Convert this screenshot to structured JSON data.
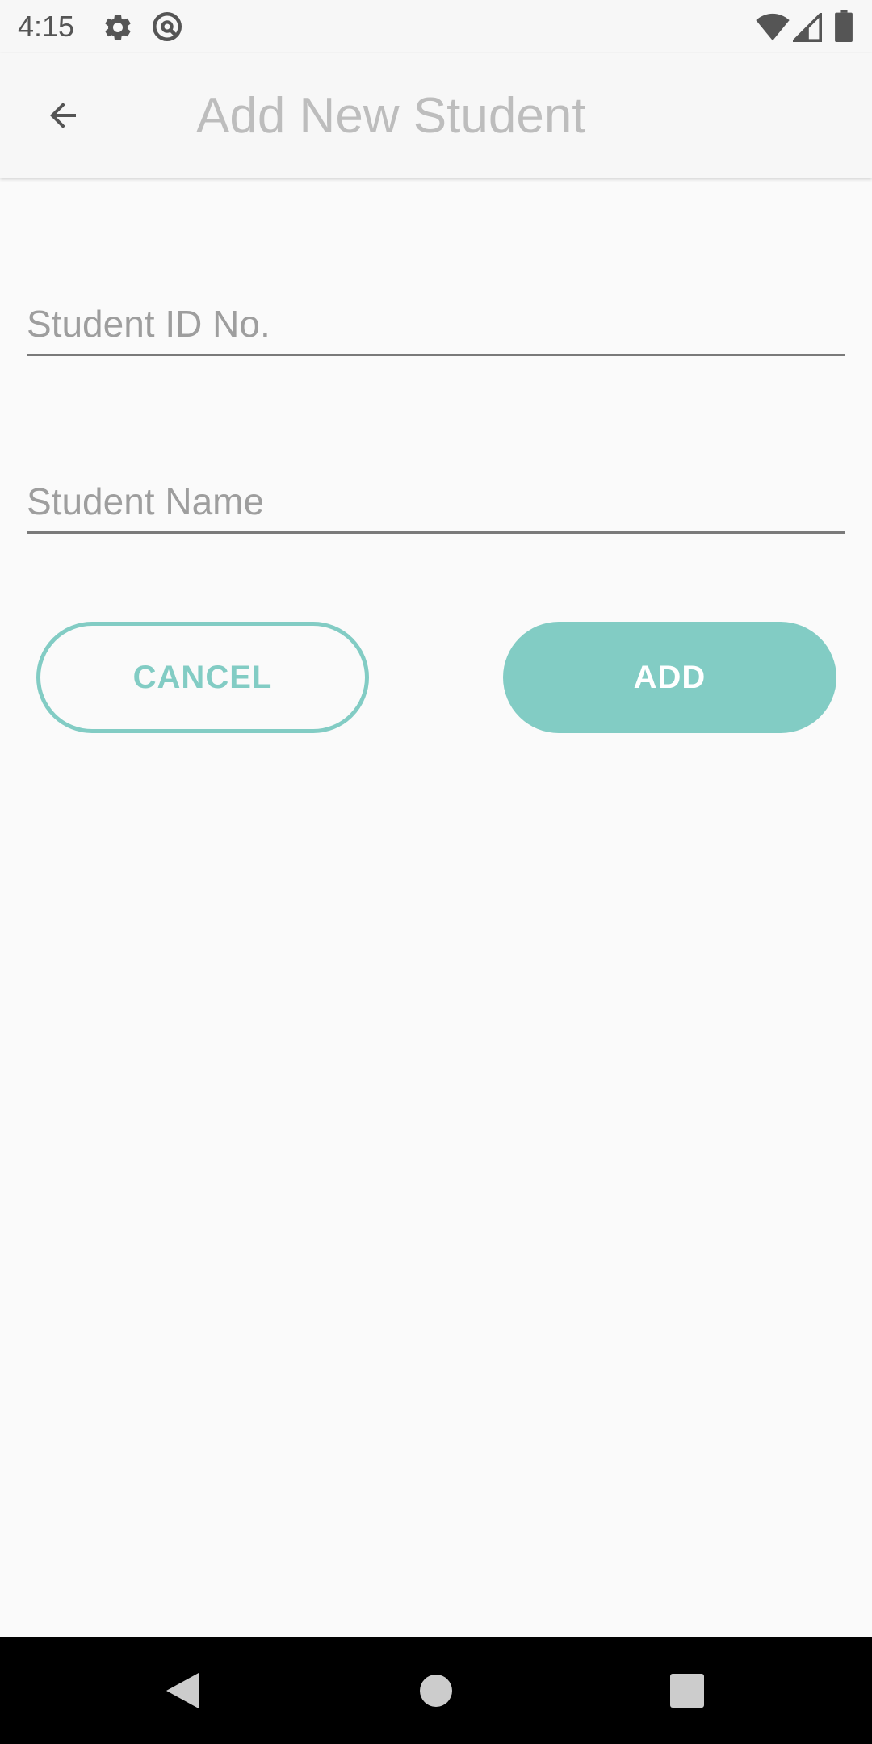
{
  "status_bar": {
    "time": "4:15",
    "icons": [
      "settings-gear-icon",
      "data-saver-icon",
      "wifi-icon",
      "cell-signal-icon",
      "battery-icon"
    ]
  },
  "app_bar": {
    "title": "Add New Student",
    "back_icon": "arrow-back-icon"
  },
  "form": {
    "student_id": {
      "placeholder": "Student ID No.",
      "value": ""
    },
    "student_name": {
      "placeholder": "Student Name",
      "value": ""
    }
  },
  "buttons": {
    "cancel_label": "CANCEL",
    "add_label": "ADD"
  },
  "nav_bar": {
    "icons": [
      "nav-back-icon",
      "nav-home-icon",
      "nav-recents-icon"
    ]
  },
  "colors": {
    "accent": "#82ccc4",
    "title_text": "#bdbdbd",
    "background": "#fafafa",
    "nav_bar": "#000000"
  }
}
